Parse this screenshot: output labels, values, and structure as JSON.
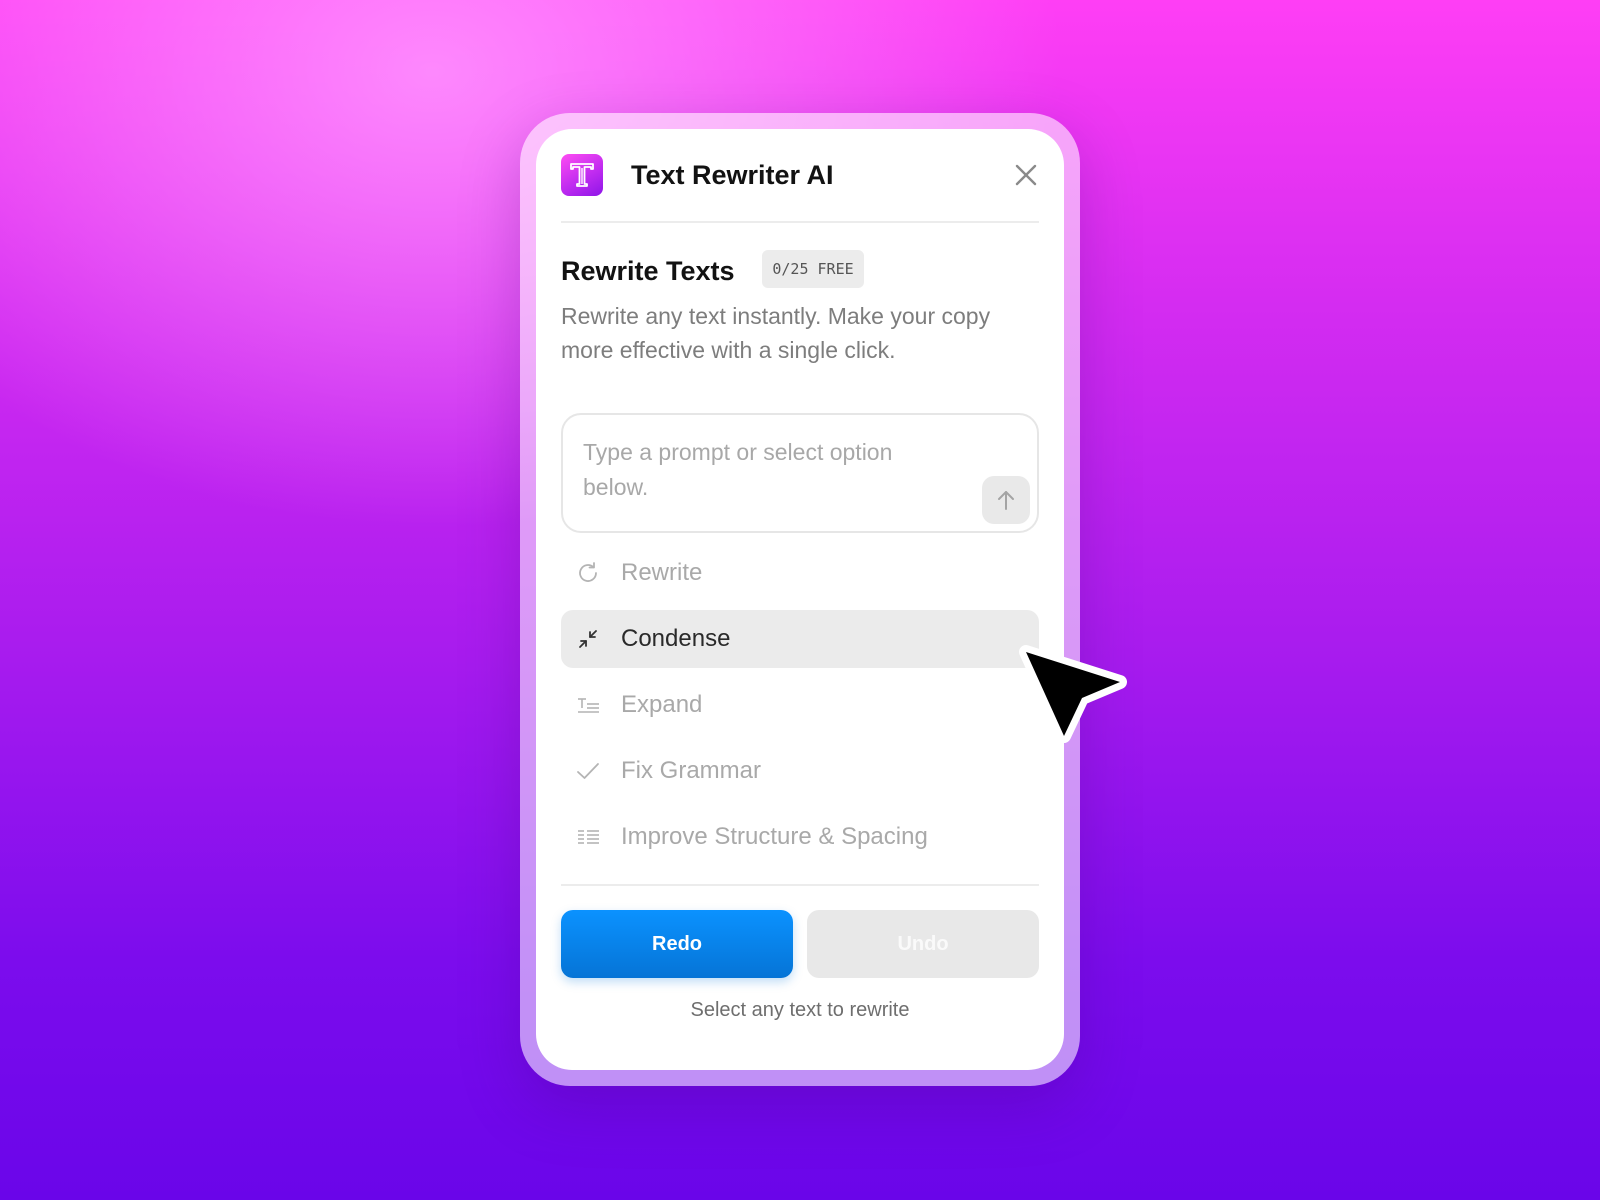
{
  "header": {
    "app_title": "Text Rewriter AI",
    "logo_icon": "letter-t-logo-icon",
    "close_icon": "close-icon"
  },
  "section": {
    "title": "Rewrite Texts",
    "usage_badge": "0/25 FREE",
    "description": "Rewrite any text instantly. Make your copy more effective with a single click."
  },
  "prompt": {
    "value": "",
    "placeholder": "Type a prompt or select option below.",
    "send_icon": "arrow-up-icon"
  },
  "options": [
    {
      "label": "Rewrite",
      "icon": "refresh-icon",
      "active": false
    },
    {
      "label": "Condense",
      "icon": "collapse-arrows-icon",
      "active": true
    },
    {
      "label": "Expand",
      "icon": "text-expand-icon",
      "active": false
    },
    {
      "label": "Fix Grammar",
      "icon": "check-icon",
      "active": false
    },
    {
      "label": "Improve Structure & Spacing",
      "icon": "align-lines-icon",
      "active": false
    }
  ],
  "actions": {
    "redo_label": "Redo",
    "undo_label": "Undo"
  },
  "footer": {
    "hint": "Select any text to rewrite"
  },
  "colors": {
    "accent_blue": "#0a86f0",
    "brand_pink": "#ff4df2",
    "brand_purple": "#8e15e8",
    "background_top": "#ff3ef5",
    "background_bottom": "#6a05e9"
  }
}
